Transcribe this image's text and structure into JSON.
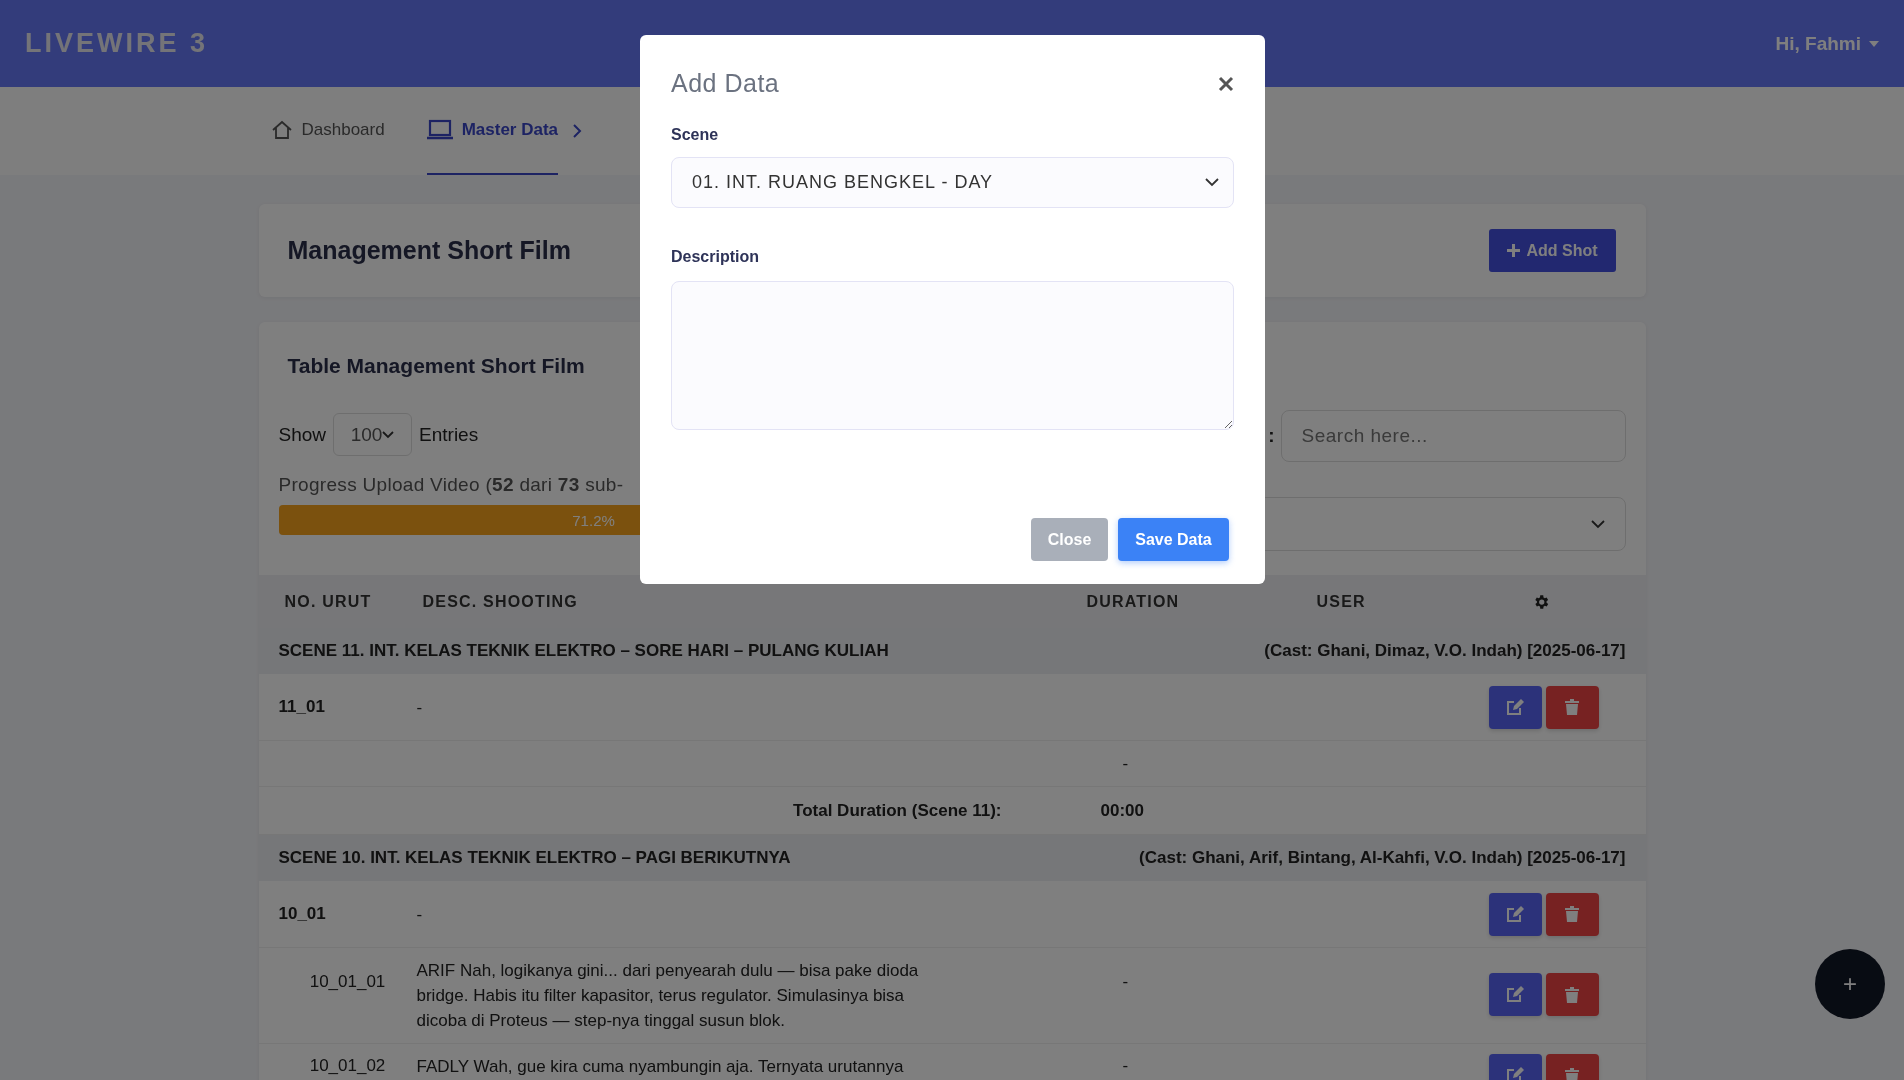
{
  "brand": "LIVEWIRE 3",
  "user_menu": {
    "label": "Hi, Fahmi"
  },
  "breadcrumbs": [
    {
      "label": "Dashboard",
      "selected": false
    },
    {
      "label": "Master Data",
      "selected": true
    }
  ],
  "header": {
    "title": "Management Short Film",
    "add_button": "Add Shot"
  },
  "table_card": {
    "title": "Table Management Short Film",
    "show_label": "Show",
    "entries_value": "100",
    "entries_label": "Entries",
    "search_label": ":",
    "search_placeholder": "Search here...",
    "progress": {
      "text": "Progress Upload Video (**52** dari **73** sub-",
      "level": 0.712,
      "reading": "71.2%"
    }
  },
  "columns": [
    "NO. URUT",
    "DESC. SHOOTING",
    "DURATION",
    "USER"
  ],
  "scenes": [
    {
      "title": "SCENE 11. INT. KELAS TEKNIK ELEKTRO – SORE HARI – PULANG KULIAH",
      "cast": "(Cast: Ghani, Dimaz, V.O. Indah) [2025-06-17]",
      "rows": [
        {
          "kind": "shot",
          "no": "11_01",
          "desc": "-"
        },
        {
          "kind": "empty",
          "duration": "-"
        }
      ],
      "total_label": "Total Duration (Scene 11):",
      "total_value": "00:00"
    },
    {
      "title": "SCENE 10. INT. KELAS TEKNIK ELEKTRO – PAGI BERIKUTNYA",
      "cast": "(Cast: Ghani, Arif, Bintang, Al-Kahfi, V.O. Indah) [2025-06-17]",
      "rows": [
        {
          "kind": "shot",
          "no": "10_01",
          "desc": "-"
        },
        {
          "kind": "sub",
          "no": "10_01_01",
          "desc": "ARIF Nah, logikanya gini... dari penyearah dulu — bisa pake dioda bridge. Habis itu filter kapasitor, terus regulator. Simulasinya bisa dicoba di Proteus — step-nya tinggal susun blok.",
          "duration": "-"
        },
        {
          "kind": "sub",
          "no": "10_01_02",
          "desc": "FADLY Wah, gue kira cuma nyambungin aja. Ternyata urutannya",
          "duration": "-"
        }
      ]
    }
  ],
  "modal": {
    "title": "Add Data",
    "scene_label": "Scene",
    "scene_value": "01. INT. RUANG BENGKEL - DAY",
    "description_label": "Description",
    "close_button": "Close",
    "save_button": "Save Data"
  },
  "fab": "+"
}
